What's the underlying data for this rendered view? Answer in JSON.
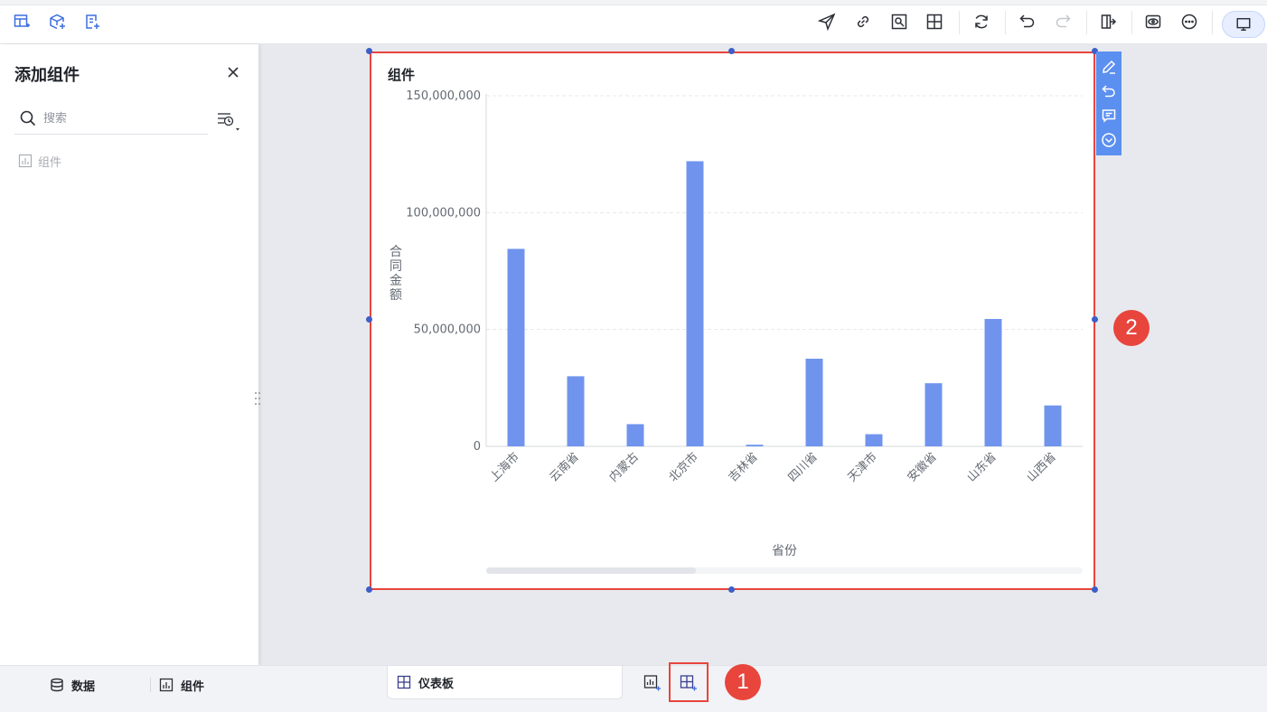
{
  "panel": {
    "title": "添加组件",
    "search_placeholder": "搜索",
    "tree_item_label": "组件"
  },
  "widget": {
    "title": "组件"
  },
  "chart_data": {
    "type": "bar",
    "categories": [
      "上海市",
      "云南省",
      "内蒙古",
      "北京市",
      "吉林省",
      "四川省",
      "天津市",
      "安徽省",
      "山东省",
      "山西省"
    ],
    "values": [
      84500000,
      30000000,
      9500000,
      122000000,
      700000,
      37500000,
      5200000,
      27000000,
      54500000,
      17500000
    ],
    "y_ticks": [
      0,
      50000000,
      100000000,
      150000000
    ],
    "y_tick_labels": [
      "0",
      "50,000,000",
      "100,000,000",
      "150,000,000"
    ],
    "ylim": [
      0,
      150000000
    ],
    "xlabel": "省份",
    "ylabel": "合同金额",
    "grid": true,
    "bar_color": "#7094ee"
  },
  "callouts": [
    "1",
    "2"
  ],
  "bottom": {
    "tab_data": "数据",
    "tab_widgets": "组件",
    "page_tab": "仪表板"
  },
  "colors": {
    "accent": "#3d6fe0",
    "highlight": "#e8453c"
  }
}
